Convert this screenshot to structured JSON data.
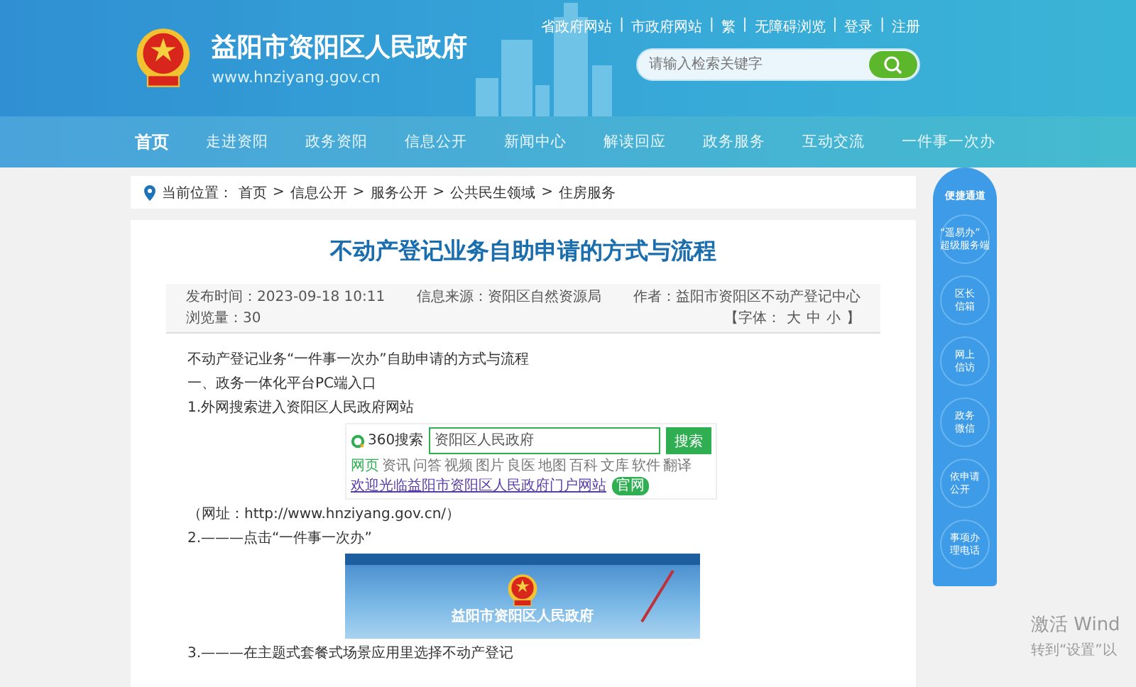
{
  "header": {
    "site_name": "益阳市资阳区人民政府",
    "site_url": "www.hnziyang.gov.cn",
    "separator": "|",
    "top_links": [
      "省政府网站",
      "市政府网站",
      "繁",
      "无障碍浏览",
      "登录",
      "注册"
    ],
    "search": {
      "placeholder": "请输入检索关键字"
    }
  },
  "nav": [
    {
      "label": "首页",
      "selected": true
    },
    {
      "label": "走进资阳",
      "selected": false
    },
    {
      "label": "政务资阳",
      "selected": false
    },
    {
      "label": "信息公开",
      "selected": false
    },
    {
      "label": "新闻中心",
      "selected": false
    },
    {
      "label": "解读回应",
      "selected": false
    },
    {
      "label": "政务服务",
      "selected": false
    },
    {
      "label": "互动交流",
      "selected": false
    },
    {
      "label": "一件事一次办",
      "selected": false
    }
  ],
  "breadcrumb": {
    "label": "当前位置：",
    "separator": ">",
    "items": [
      "首页",
      "信息公开",
      "服务公开",
      "公共民生领域",
      "住房服务"
    ]
  },
  "article": {
    "title": "不动产登记业务自助申请的方式与流程",
    "meta": [
      "发布时间：2023-09-18 10:11",
      "信息来源：资阳区自然资源局",
      "作者：益阳市资阳区不动产登记中心",
      "浏览量：30"
    ],
    "font_size": {
      "open": "【字体：",
      "options": [
        "大",
        "中",
        "小"
      ],
      "close": "】"
    },
    "blocks": [
      {
        "kind": "text",
        "text": "不动产登记业务“一件事一次办”自助申请的方式与流程"
      },
      {
        "kind": "text",
        "text": "一、政务一体化平台PC端入口"
      },
      {
        "kind": "text",
        "text": "1.外网搜索进入资阳区人民政府网站"
      },
      {
        "kind": "search_screenshot",
        "logo": "360搜索",
        "query": "资阳区人民政府",
        "button": "搜索",
        "tabs": [
          "网页",
          "资讯",
          "问答",
          "视频",
          "图片",
          "良医",
          "地图",
          "百科",
          "文库",
          "软件",
          "翻译"
        ],
        "result": "欢迎光临益阳市资阳区人民政府门户网站",
        "badge": "官网"
      },
      {
        "kind": "text",
        "text": "（网址：http://www.hnziyang.gov.cn/）"
      },
      {
        "kind": "text",
        "text": "2.———点击“一件事一次办”"
      },
      {
        "kind": "site_screenshot",
        "title": "益阳市资阳区人民政府"
      },
      {
        "kind": "text",
        "text": "3.———在主题式套餐式场景应用里选择不动产登记"
      }
    ]
  },
  "sidebar": {
    "title": "便捷通道",
    "items": [
      {
        "lines": [
          "“遥易办”",
          "超级服务端"
        ]
      },
      {
        "lines": [
          "区长",
          "信箱"
        ]
      },
      {
        "lines": [
          "网上",
          "信访"
        ]
      },
      {
        "lines": [
          "政务",
          "微信"
        ]
      },
      {
        "lines": [
          "依申请",
          "公开"
        ]
      },
      {
        "lines": [
          "事项办",
          "理电话"
        ]
      }
    ]
  },
  "windows_notice": {
    "title": "激活 Wind",
    "subtitle": "转到“设置”以"
  }
}
